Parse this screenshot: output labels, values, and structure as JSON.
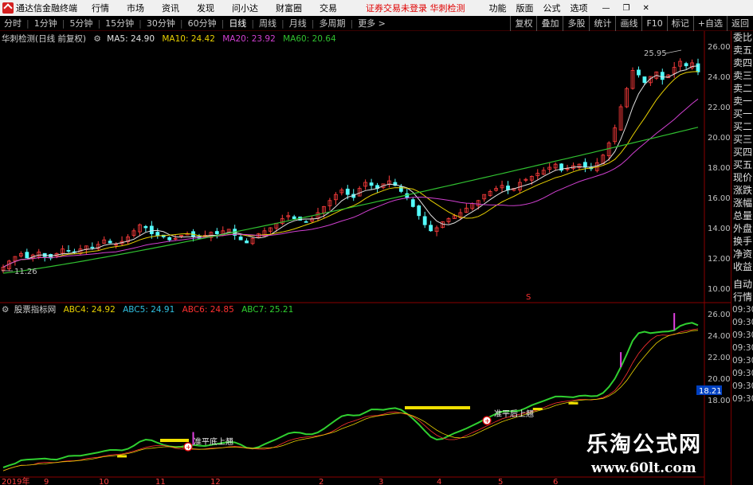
{
  "menubar": {
    "app_name": "通达信金融终端",
    "items": [
      "行情",
      "市场",
      "资讯",
      "发现",
      "问小达",
      "财富圈",
      "交易"
    ],
    "warning": "证券交易未登录  华刺检测",
    "right_items": [
      "功能",
      "版面",
      "公式",
      "选项"
    ]
  },
  "toolbar": {
    "periods": [
      "分时",
      "1分钟",
      "5分钟",
      "15分钟",
      "30分钟",
      "60分钟",
      "日线",
      "周线",
      "月线",
      "多周期",
      "更多 >"
    ],
    "active_period": "日线",
    "right_buttons": [
      "复权",
      "叠加",
      "多股",
      "统计",
      "画线",
      "F10",
      "标记",
      "+自选",
      "返回"
    ]
  },
  "main_legend": {
    "title": "华刺检测(日线 前复权)",
    "ma": [
      {
        "label": "MA5: 24.90",
        "color": "#e0e0e0"
      },
      {
        "label": "MA10: 24.42",
        "color": "#e8d000"
      },
      {
        "label": "MA20: 23.92",
        "color": "#d040d0"
      },
      {
        "label": "MA60: 20.64",
        "color": "#30c030"
      }
    ]
  },
  "sub_legend": {
    "title": "股票指标网",
    "abc": [
      {
        "label": "ABC4: 24.92",
        "color": "#e8d000"
      },
      {
        "label": "ABC5: 24.91",
        "color": "#30c0e0"
      },
      {
        "label": "ABC6: 24.85",
        "color": "#ff3030"
      },
      {
        "label": "ABC7: 25.21",
        "color": "#30d030"
      }
    ]
  },
  "price_axis": {
    "main": [
      "26.00",
      "24.00",
      "22.00",
      "20.00",
      "18.00",
      "16.00",
      "14.00",
      "12.00",
      "10.00"
    ],
    "sub": [
      "26.00",
      "24.00",
      "22.00",
      "20.00",
      "18.00"
    ],
    "current_tag": "18.21"
  },
  "annotations": {
    "high": "25.95",
    "low": "11.26",
    "signal1": "准平底上翘",
    "signal2": "准平后上翘"
  },
  "date_axis": [
    "2019年",
    "9",
    "10",
    "11",
    "12",
    "2",
    "3",
    "4",
    "5",
    "6"
  ],
  "side_panel": {
    "items": [
      "委比",
      "卖五",
      "卖四",
      "卖三",
      "卖二",
      "卖一",
      "买一",
      "买二",
      "买三",
      "买四",
      "买五",
      "现价",
      "涨跌",
      "涨幅",
      "总量",
      "外盘",
      "换手",
      "净资",
      "收益",
      "自动",
      "行情"
    ],
    "times": [
      "09:30",
      "09:30",
      "09:30",
      "09:30",
      "09:30",
      "09:30",
      "09:30",
      "09:30"
    ]
  },
  "watermark": {
    "title": "乐淘公式网",
    "url": "www.60lt.com"
  },
  "colors": {
    "up": "#ff3c3c",
    "down": "#54fcfc",
    "ma5": "#e0e0e0",
    "ma10": "#e8d000",
    "ma20": "#d040d0",
    "ma60": "#30c030",
    "axis_border": "#8a0000",
    "warning": "#e00000"
  },
  "chart_data": {
    "type": "candlestick",
    "main_ylim": [
      10,
      26
    ],
    "sub_ylim": [
      16,
      26
    ],
    "closes": [
      11.4,
      11.8,
      12.1,
      12.3,
      12.0,
      12.2,
      12.4,
      12.1,
      12.0,
      12.3,
      12.6,
      12.5,
      12.4,
      12.6,
      12.8,
      12.7,
      12.9,
      13.2,
      13.0,
      12.9,
      13.1,
      13.4,
      13.8,
      14.2,
      14.0,
      13.6,
      13.5,
      13.4,
      13.2,
      13.3,
      13.5,
      13.6,
      13.4,
      13.3,
      13.5,
      13.7,
      13.6,
      13.8,
      13.9,
      13.5,
      13.2,
      13.0,
      13.3,
      13.6,
      13.8,
      14.0,
      14.3,
      14.6,
      14.8,
      14.6,
      14.5,
      14.4,
      14.6,
      15.0,
      15.4,
      15.8,
      16.2,
      16.5,
      16.2,
      16.0,
      16.6,
      17.0,
      16.8,
      16.6,
      16.9,
      17.1,
      16.8,
      16.4,
      16.0,
      15.4,
      14.8,
      14.2,
      13.8,
      14.0,
      14.4,
      14.6,
      14.8,
      15.0,
      15.3,
      15.6,
      15.8,
      16.2,
      16.4,
      16.6,
      16.8,
      16.5,
      16.6,
      17.0,
      17.2,
      17.4,
      17.6,
      17.8,
      18.0,
      18.2,
      17.8,
      17.9,
      18.1,
      18.2,
      18.0,
      17.9,
      18.3,
      18.8,
      19.6,
      20.6,
      22.0,
      23.2,
      24.4,
      24.1,
      23.6,
      24.0,
      24.3,
      23.8,
      24.1,
      24.6,
      25.0,
      24.7,
      24.9,
      24.3
    ],
    "ma60_end": 20.64,
    "labels": {
      "high": 25.95,
      "low": 11.26
    }
  }
}
